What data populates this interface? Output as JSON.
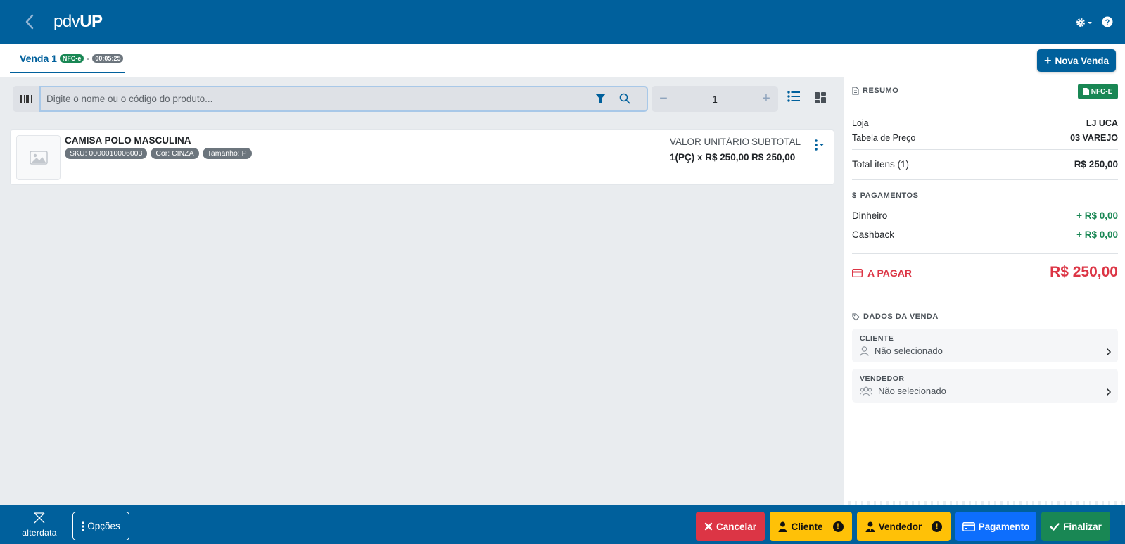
{
  "header": {
    "logo_left": "pdv",
    "logo_right": "UP"
  },
  "tab": {
    "title": "Venda 1",
    "badge": "NFC-e",
    "separator": "-",
    "time": "00:05:25"
  },
  "new_sale_label": "Nova Venda",
  "search": {
    "placeholder": "Digite o nome ou o código do produto..."
  },
  "quantity": {
    "minus": "−",
    "value": "1",
    "plus": "+"
  },
  "product": {
    "name": "CAMISA POLO MASCULINA",
    "tags": [
      "SKU: 0000010006003",
      "Cor: CINZA",
      "Tamanho: P"
    ],
    "unit_header": "VALOR UNITÁRIO",
    "subtotal_header": "SUBTOTAL",
    "unit_value": "1(PÇ) x R$ 250,00",
    "subtotal_value": "R$ 250,00"
  },
  "summary": {
    "title": "RESUMO",
    "nfce_button": "NFC-E",
    "loja_label": "Loja",
    "loja_value": "LJ UCA",
    "tabela_label": "Tabela de Preço",
    "tabela_value": "03 VAREJO",
    "total_label": "Total itens (1)",
    "total_value": "R$ 250,00",
    "payments_title": "PAGAMENTOS",
    "payments": [
      {
        "label": "Dinheiro",
        "value": "+ R$ 0,00"
      },
      {
        "label": "Cashback",
        "value": "+ R$ 0,00"
      }
    ],
    "apagar_label": "A PAGAR",
    "apagar_value": "R$ 250,00",
    "dados_title": "DADOS DA VENDA",
    "cliente_label": "CLIENTE",
    "cliente_value": "Não selecionado",
    "vendedor_label": "VENDEDOR",
    "vendedor_value": "Não selecionado"
  },
  "footer": {
    "brand": "alterdata",
    "opcoes": "Opções",
    "cancelar": "Cancelar",
    "cliente": "Cliente",
    "vendedor": "Vendedor",
    "pagamento": "Pagamento",
    "finalizar": "Finalizar"
  },
  "colors": {
    "primary": "#00609c",
    "success": "#198754",
    "danger": "#dc3545",
    "warning": "#ffc107",
    "info": "#0d6efd"
  }
}
